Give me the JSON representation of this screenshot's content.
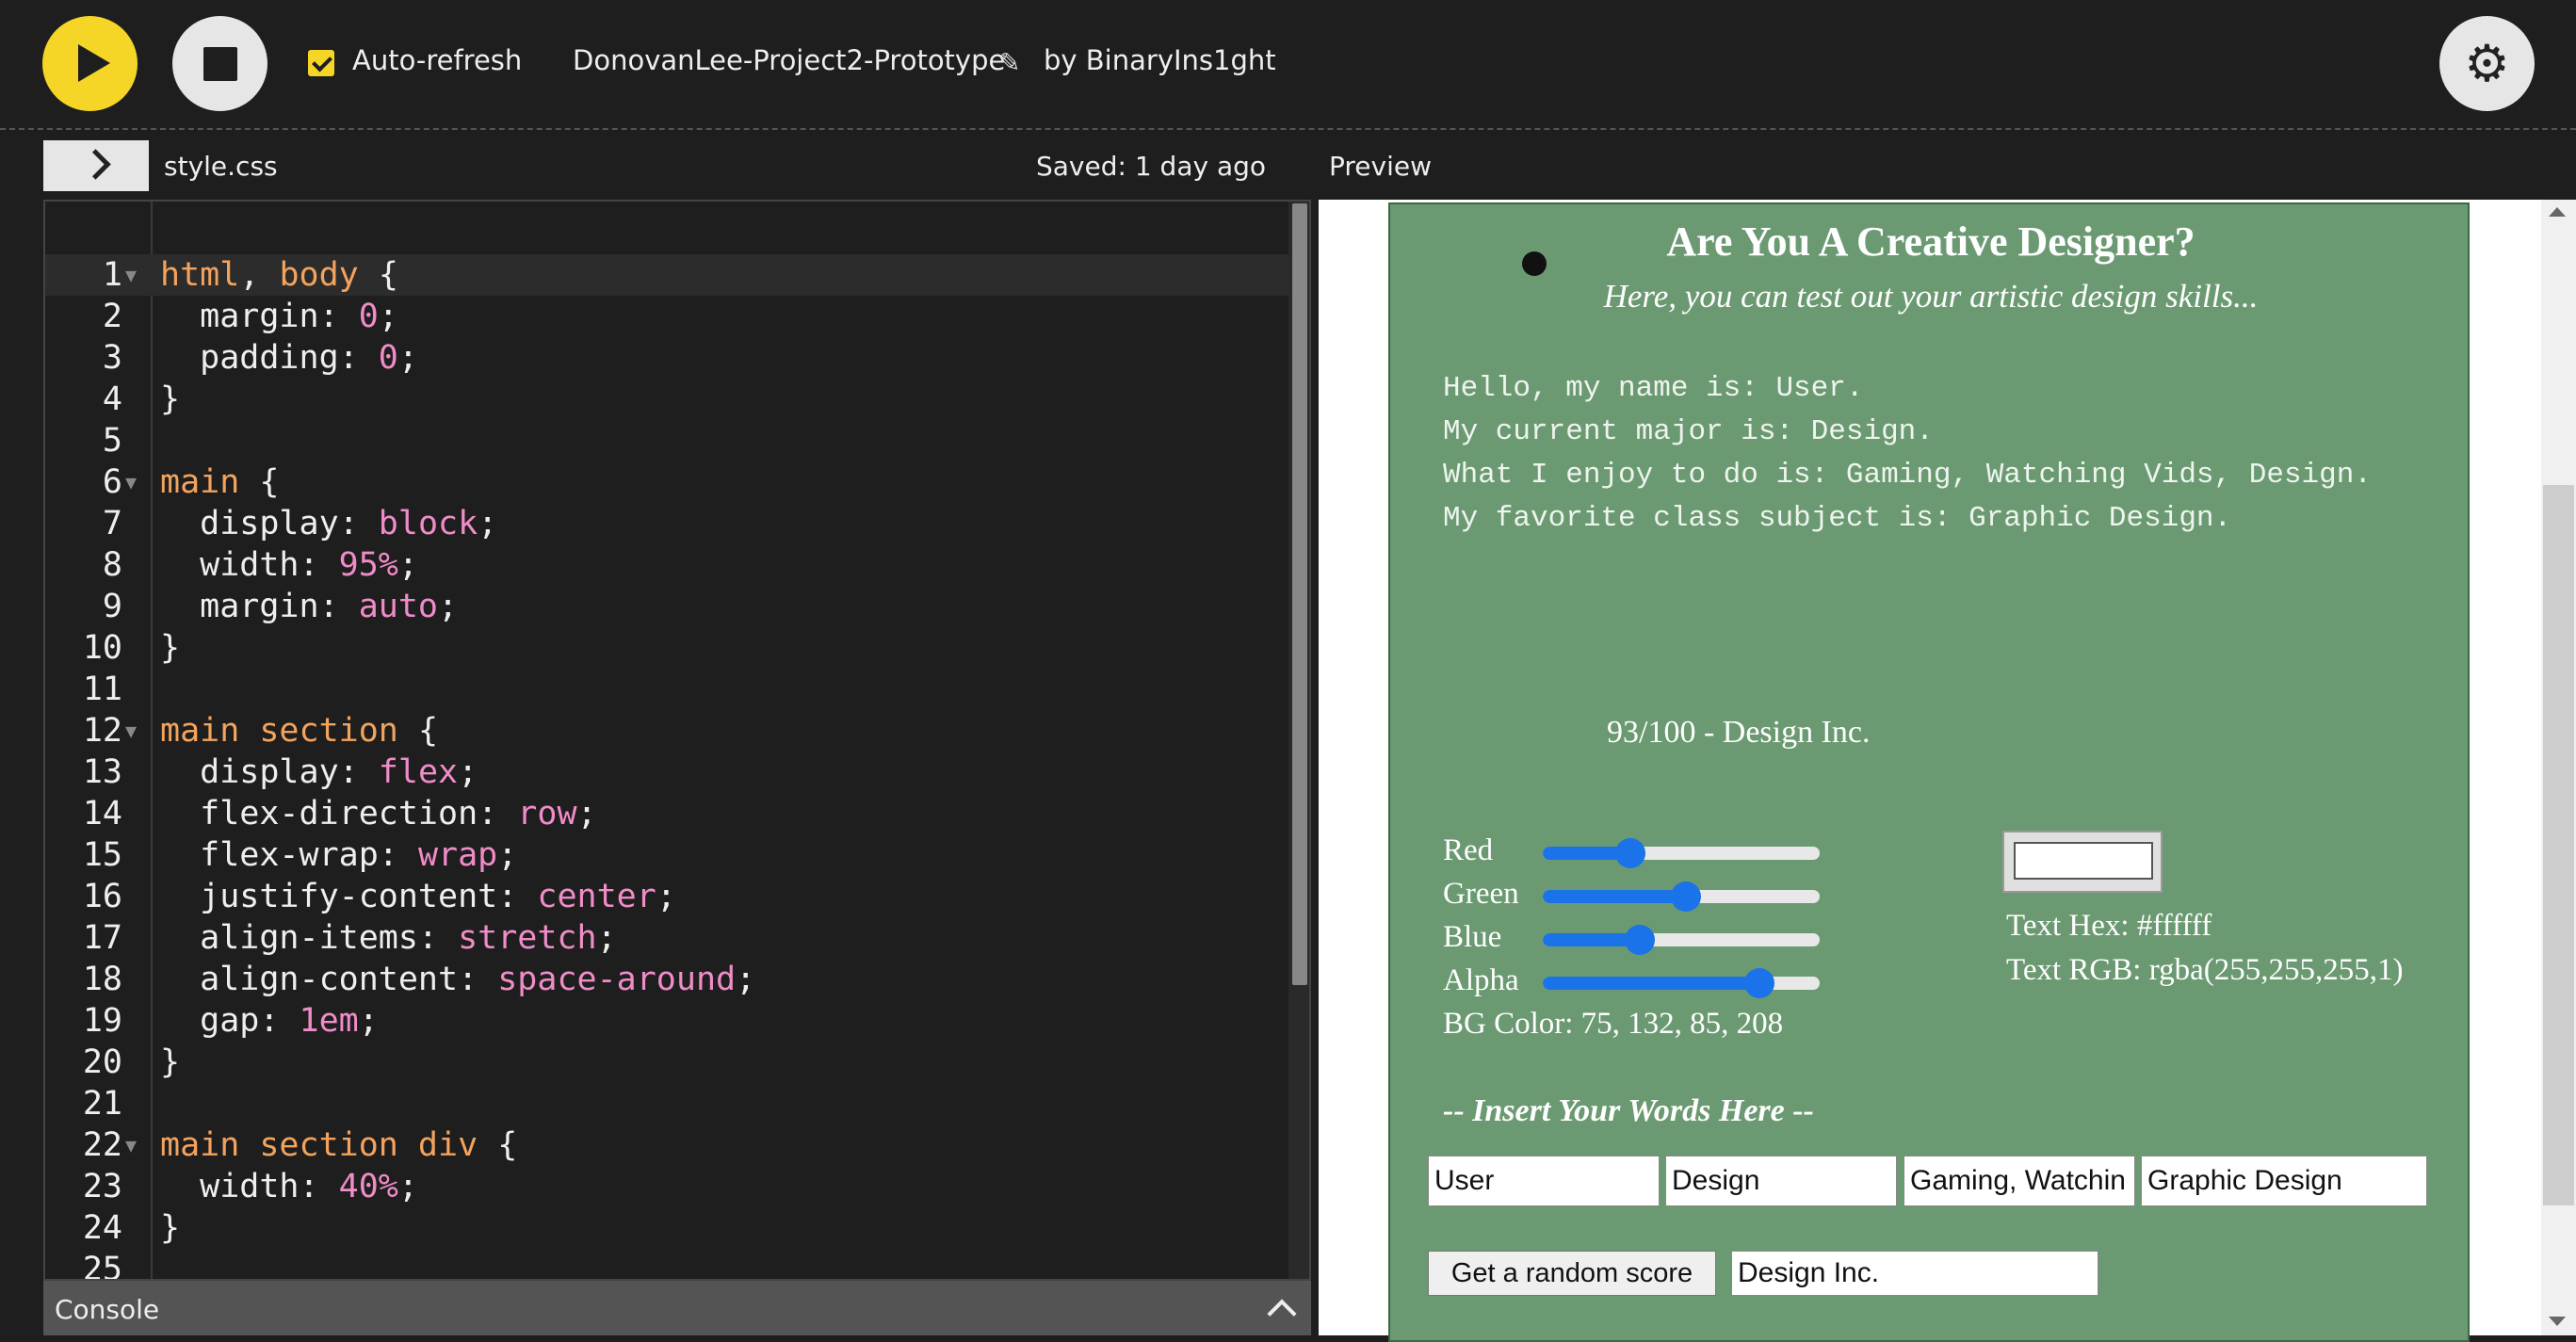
{
  "toolbar": {
    "play_icon": "play-icon",
    "stop_icon": "stop-icon",
    "auto_refresh_label": "Auto-refresh",
    "auto_refresh_checked": true,
    "project_name": "DonovanLee-Project2-Prototype",
    "by_author": "by BinaryIns1ght",
    "settings_icon": "gear-icon",
    "accent": "#f5d627"
  },
  "editor": {
    "filename": "style.css",
    "saved": "Saved: 1 day ago",
    "lines": [
      {
        "n": "1",
        "fold": true,
        "text": "html, body {"
      },
      {
        "n": "2",
        "fold": false,
        "text": "  margin: 0;"
      },
      {
        "n": "3",
        "fold": false,
        "text": "  padding: 0;"
      },
      {
        "n": "4",
        "fold": false,
        "text": "}"
      },
      {
        "n": "5",
        "fold": false,
        "text": ""
      },
      {
        "n": "6",
        "fold": true,
        "text": "main {"
      },
      {
        "n": "7",
        "fold": false,
        "text": "  display: block;"
      },
      {
        "n": "8",
        "fold": false,
        "text": "  width: 95%;"
      },
      {
        "n": "9",
        "fold": false,
        "text": "  margin: auto;"
      },
      {
        "n": "10",
        "fold": false,
        "text": "}"
      },
      {
        "n": "11",
        "fold": false,
        "text": ""
      },
      {
        "n": "12",
        "fold": true,
        "text": "main section {"
      },
      {
        "n": "13",
        "fold": false,
        "text": "  display: flex;"
      },
      {
        "n": "14",
        "fold": false,
        "text": "  flex-direction: row;"
      },
      {
        "n": "15",
        "fold": false,
        "text": "  flex-wrap: wrap;"
      },
      {
        "n": "16",
        "fold": false,
        "text": "  justify-content: center;"
      },
      {
        "n": "17",
        "fold": false,
        "text": "  align-items: stretch;"
      },
      {
        "n": "18",
        "fold": false,
        "text": "  align-content: space-around;"
      },
      {
        "n": "19",
        "fold": false,
        "text": "  gap: 1em;"
      },
      {
        "n": "20",
        "fold": false,
        "text": "}"
      },
      {
        "n": "21",
        "fold": false,
        "text": ""
      },
      {
        "n": "22",
        "fold": true,
        "text": "main section div {"
      },
      {
        "n": "23",
        "fold": false,
        "text": "  width: 40%;"
      },
      {
        "n": "24",
        "fold": false,
        "text": "}"
      },
      {
        "n": "25",
        "fold": false,
        "text": ""
      }
    ]
  },
  "console": {
    "label": "Console"
  },
  "preview": {
    "label": "Preview",
    "title": "Are You A Creative Designer?",
    "subtitle": "Here, you can test out your artistic design skills...",
    "intro_lines": [
      "Hello, my name is: User.",
      "My current major is: Design.",
      "What I enjoy to do is: Gaming, Watching Vids, Design.",
      "My favorite class subject is: Graphic Design."
    ],
    "score_text": "93/100 - Design Inc.",
    "sliders": [
      {
        "label": "Red",
        "value": 75,
        "max": 255
      },
      {
        "label": "Green",
        "value": 132,
        "max": 255
      },
      {
        "label": "Blue",
        "value": 85,
        "max": 255
      },
      {
        "label": "Alpha",
        "value": 208,
        "max": 255
      }
    ],
    "bg_color": "BG Color: 75, 132, 85, 208",
    "text_hex": "Text Hex: #ffffff",
    "text_rgb": "Text RGB: rgba(255,255,255,1)",
    "insert_label": "-- Insert Your Words Here --",
    "inputs": [
      "User",
      "Design",
      "Gaming, Watchin",
      "Graphic Design"
    ],
    "random_button": "Get a random score",
    "company_input": "Design Inc.",
    "bg": "#6b9a72",
    "slider_color": "#1a73e8"
  }
}
